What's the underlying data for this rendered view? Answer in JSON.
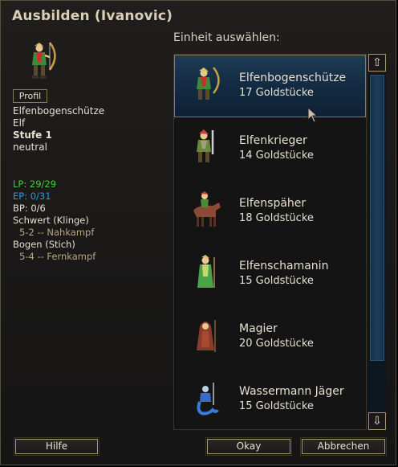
{
  "dialog": {
    "title": "Ausbilden (Ivanovic)"
  },
  "unit_info": {
    "profile_button": "Profil",
    "type": "Elfenbogenschütze",
    "race": "Elf",
    "level": "Stufe 1",
    "alignment": "neutral",
    "hp": "LP: 29/29",
    "xp": "EP: 0/31",
    "mp": "BP: 0/6",
    "attacks": [
      {
        "name": "Schwert (Klinge)",
        "detail": "5-2 -- Nahkampf"
      },
      {
        "name": "Bogen (Stich)",
        "detail": "5-4 -- Fernkampf"
      }
    ]
  },
  "list": {
    "label": "Einheit auswählen:",
    "units": [
      {
        "name": "Elfenbogenschütze",
        "cost": "17 Goldstücke",
        "selected": true,
        "icon": "elf-archer-icon",
        "color": "#3d8a3a"
      },
      {
        "name": "Elfenkrieger",
        "cost": "14 Goldstücke",
        "selected": false,
        "icon": "elf-fighter-icon",
        "color": "#6a8a3a"
      },
      {
        "name": "Elfenspäher",
        "cost": "18 Goldstücke",
        "selected": false,
        "icon": "elf-scout-icon",
        "color": "#8a4a36"
      },
      {
        "name": "Elfenschamanin",
        "cost": "15 Goldstücke",
        "selected": false,
        "icon": "elf-shaman-icon",
        "color": "#4aa34a"
      },
      {
        "name": "Magier",
        "cost": "20 Goldstücke",
        "selected": false,
        "icon": "mage-icon",
        "color": "#8a3a2a"
      },
      {
        "name": "Wassermann Jäger",
        "cost": "15 Goldstücke",
        "selected": false,
        "icon": "merman-hunter-icon",
        "color": "#3a6ac8"
      }
    ]
  },
  "scroll": {
    "up_icon": "⇧",
    "down_icon": "⇩"
  },
  "buttons": {
    "help": "Hilfe",
    "ok": "Okay",
    "cancel": "Abbrechen"
  },
  "colors": {
    "selected_row": "#1a3550",
    "hp": "#3cd23c",
    "xp": "#2a9ae0",
    "border_gold": "#a59670"
  }
}
